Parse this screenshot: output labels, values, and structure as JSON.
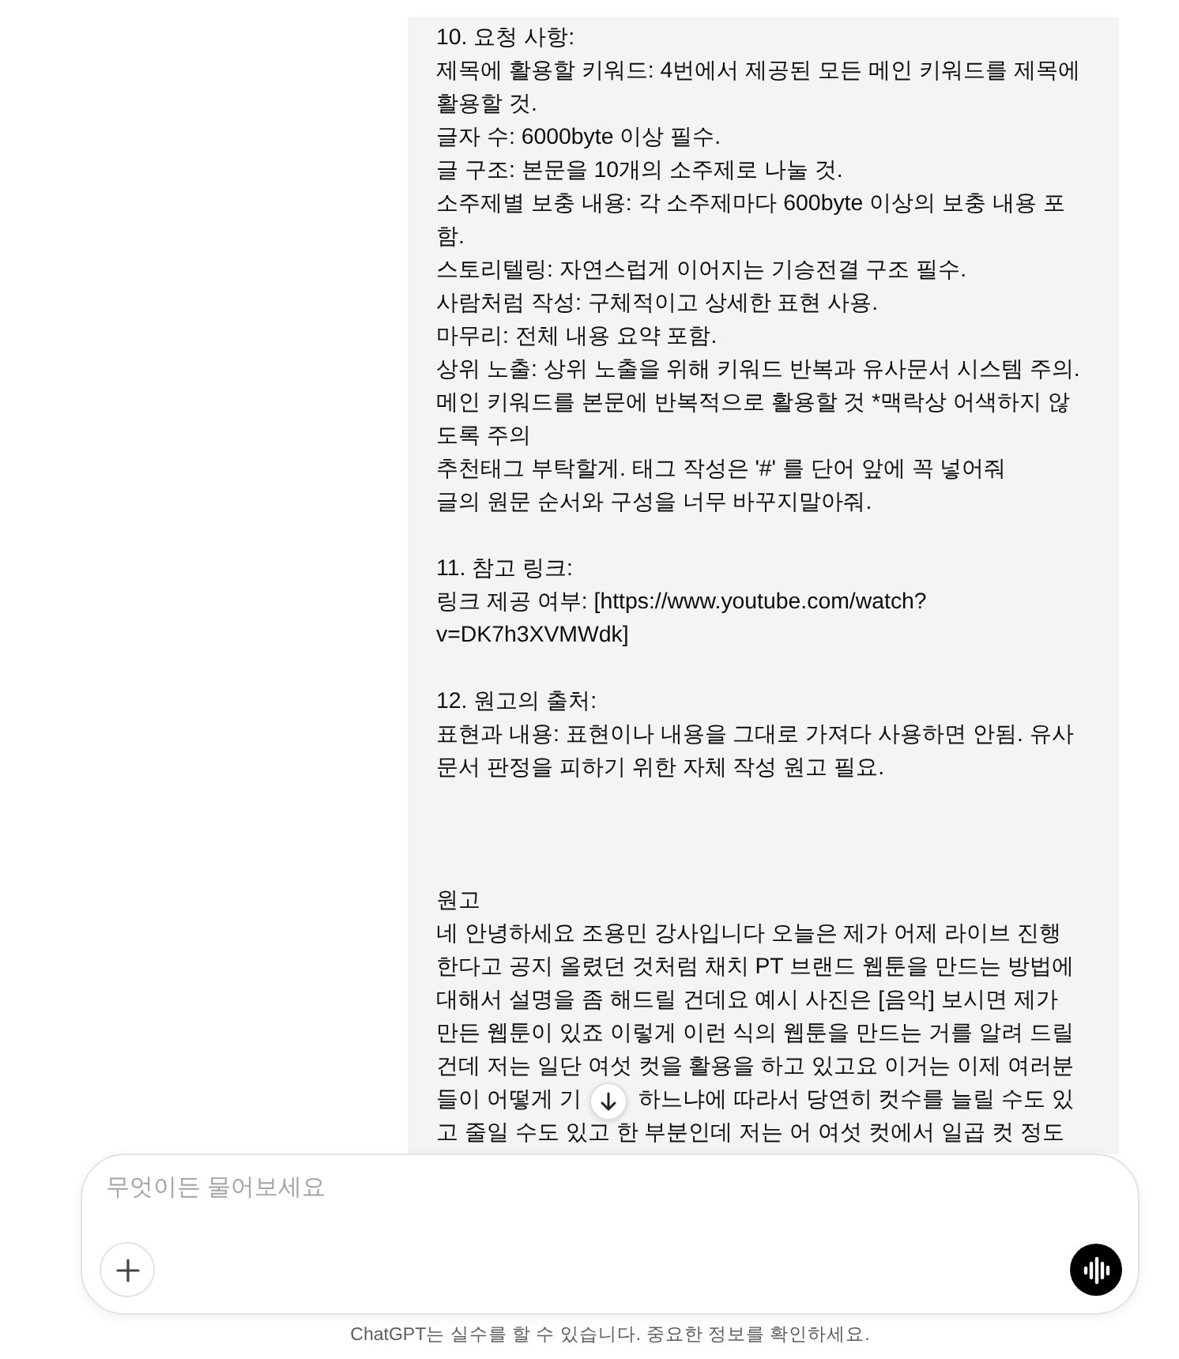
{
  "message": {
    "sections": [
      {
        "heading": "10. 요청 사항:",
        "lines": [
          "제목에 활용할 키워드: 4번에서 제공된 모든 메인 키워드를 제목에 활용할 것.",
          "글자 수: 6000byte 이상 필수.",
          "글 구조: 본문을 10개의 소주제로 나눌 것.",
          "소주제별 보충 내용: 각 소주제마다 600byte 이상의 보충 내용 포함.",
          "스토리텔링: 자연스럽게 이어지는 기승전결 구조 필수.",
          "사람처럼 작성: 구체적이고 상세한 표현 사용.",
          "마무리: 전체 내용 요약 포함.",
          "상위 노출: 상위 노출을 위해 키워드 반복과 유사문서 시스템 주의.",
          "메인 키워드를 본문에 반복적으로 활용할 것 *맥락상 어색하지 않도록 주의",
          "추천태그 부탁할게. 태그 작성은 '#' 를 단어 앞에 꼭 넣어줘",
          "글의 원문 순서와 구성을 너무 바꾸지말아줘."
        ]
      },
      {
        "heading": "11. 참고 링크:",
        "lines": [
          "링크 제공 여부: [https://www.youtube.com/watch?v=DK7h3XVMWdk]"
        ]
      },
      {
        "heading": "12. 원고의 출처:",
        "lines": [
          "표현과 내용: 표현이나 내용을 그대로 가져다 사용하면 안됨. 유사문서 판정을 피하기 위한 자체 작성 원고 필요."
        ]
      }
    ],
    "manuscript": {
      "title": "원고",
      "text": "네 안녕하세요 조용민 강사입니다 오늘은 제가 어제 라이브 진행한다고 공지 올렸던 것처럼 채치 PT 브랜드 웹툰을 만드는 방법에 대해서 설명을 좀 해드릴 건데요 예시 사진은 [음악] 보시면 제가 만든 웹툰이 있죠 이렇게 이런 식의 웹툰을 만드는 거를 알려 드릴 건데 저는 일단 여섯 컷을 활용을 하고 있고요 이거는 이제 여러분",
      "covered_line": {
        "before": "들이 어떻게 기",
        "after": "하느냐에 따라서 당연히 컷수를 늘릴 수도 있"
      },
      "text_after": "고 줄일 수도 있고 한 부분인데 저는 어 여섯 컷에서 일곱 컷 정도"
    }
  },
  "composer": {
    "placeholder": "무엇이든 물어보세요"
  },
  "footer": "ChatGPT는 실수를 할 수 있습니다. 중요한 정보를 확인하세요."
}
